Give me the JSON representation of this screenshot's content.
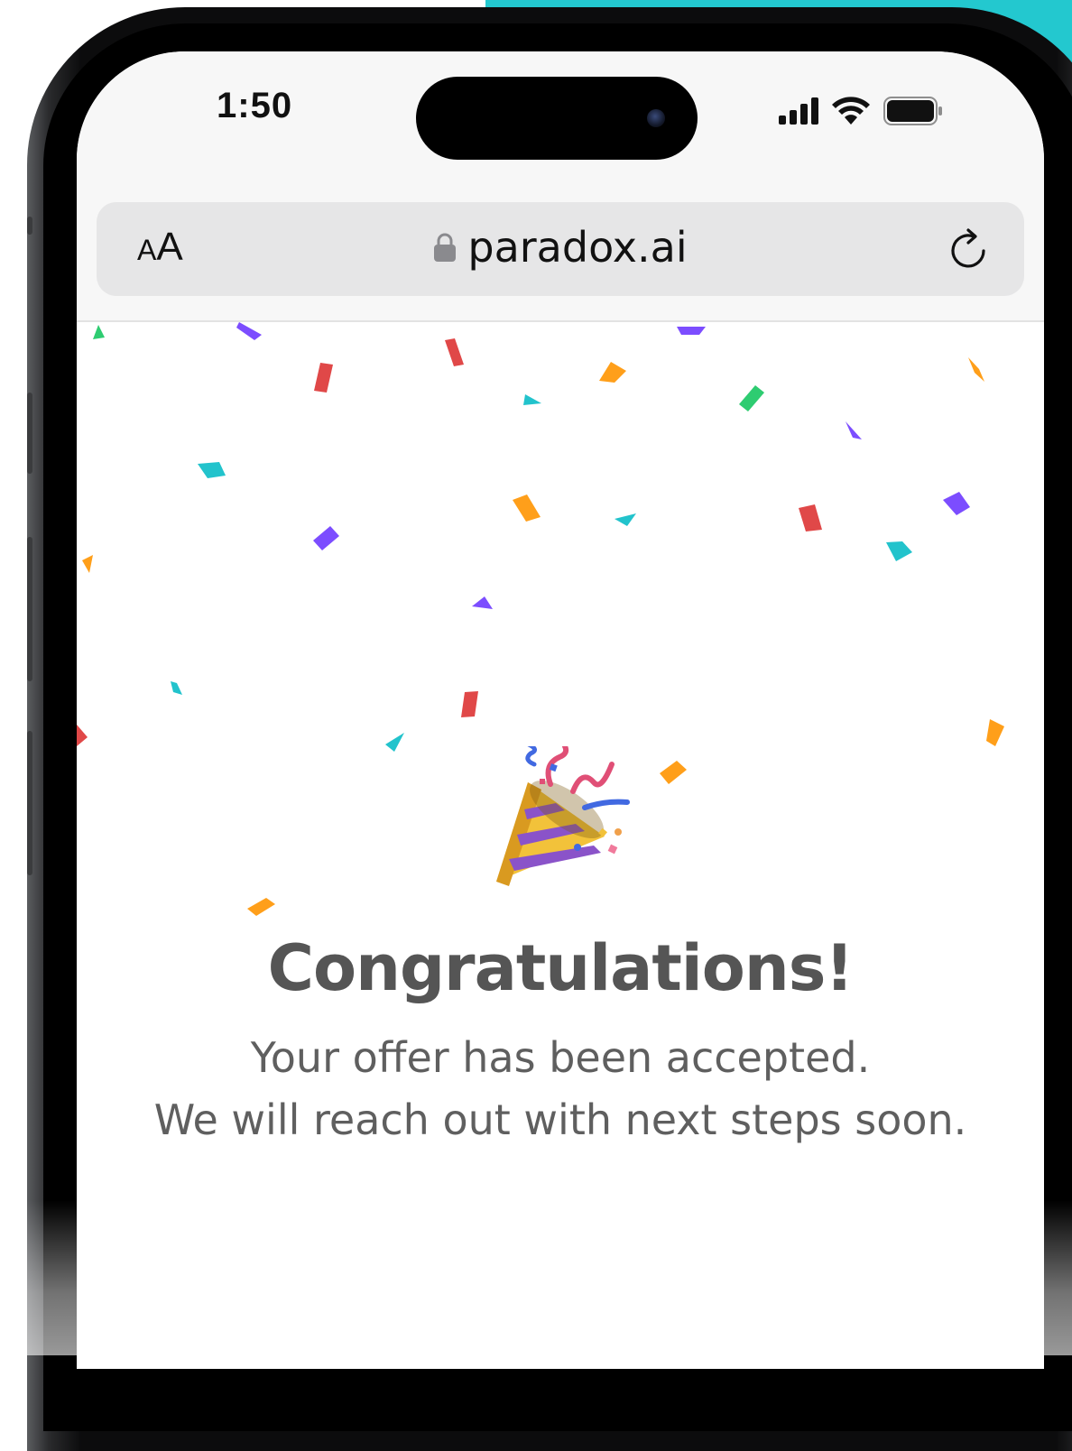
{
  "status_bar": {
    "time": "1:50",
    "icons": [
      "cellular-signal-icon",
      "wifi-icon",
      "battery-icon"
    ]
  },
  "browser": {
    "text_size_label_small": "A",
    "text_size_label_large": "A",
    "url": "paradox.ai",
    "lock_icon": "lock-icon",
    "reload_icon": "reload-icon"
  },
  "page": {
    "emoji": "🎉",
    "heading": "Congratulations!",
    "line1": "Your offer has been accepted.",
    "line2": "We will reach out with next steps soon."
  },
  "colors": {
    "accent_teal": "#23c8cf",
    "heading": "#555555",
    "body_text": "#5f5f5f",
    "confetti": [
      "#7c4dff",
      "#e04848",
      "#ff9f1a",
      "#22c3cc",
      "#2ecc71"
    ]
  }
}
